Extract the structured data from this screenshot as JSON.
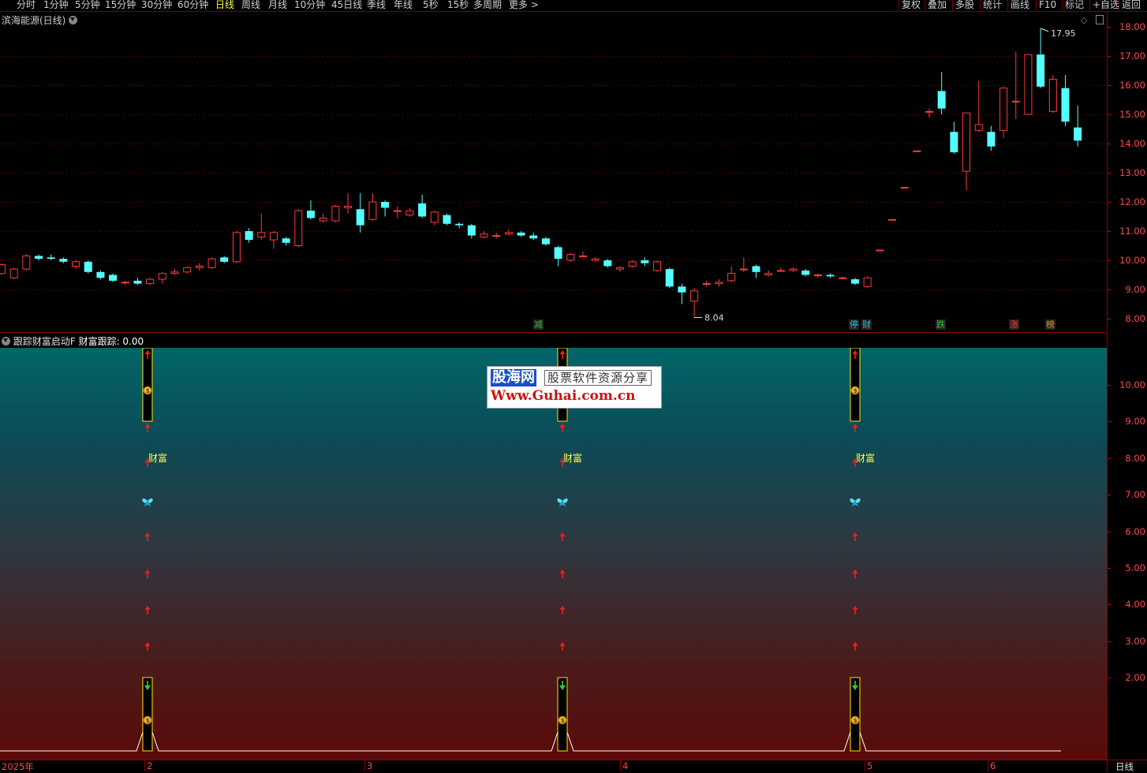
{
  "toolbar": {
    "periods": [
      {
        "label": "分时",
        "active": false
      },
      {
        "label": "1分钟",
        "active": false
      },
      {
        "label": "5分钟",
        "active": false
      },
      {
        "label": "15分钟",
        "active": false
      },
      {
        "label": "30分钟",
        "active": false
      },
      {
        "label": "60分钟",
        "active": false
      },
      {
        "label": "日线",
        "active": true
      },
      {
        "label": "周线",
        "active": false
      },
      {
        "label": "月线",
        "active": false
      },
      {
        "label": "10分钟",
        "active": false
      },
      {
        "label": "45日线",
        "active": false
      },
      {
        "label": "季线",
        "active": false
      },
      {
        "label": "年线",
        "active": false
      },
      {
        "label": "5秒",
        "active": false
      },
      {
        "label": "15秒",
        "active": false
      },
      {
        "label": "多周期",
        "active": false
      },
      {
        "label": "更多 >",
        "active": false
      }
    ],
    "right_items": [
      "复权",
      "叠加",
      "多股",
      "统计",
      "画线",
      "F10",
      "标记",
      "+自选",
      "返回"
    ]
  },
  "main": {
    "title": "滨海能源(日线)",
    "high_label": "17.95",
    "low_label": "8.04",
    "axis_ticks": [
      "18.00",
      "17.00",
      "16.00",
      "15.00",
      "14.00",
      "13.00",
      "12.00",
      "11.00",
      "10.00",
      "9.00",
      "8.00"
    ],
    "marks": [
      {
        "text": "减",
        "color": "#2fbf2f"
      },
      {
        "text": "停",
        "color": "#2fb8d8"
      },
      {
        "text": "财",
        "color": "#2fb8d8"
      },
      {
        "text": "跌",
        "color": "#2fbf2f"
      },
      {
        "text": "涨",
        "color": "#ff3b3b"
      },
      {
        "text": "榜",
        "color": "#e69020"
      }
    ]
  },
  "indicator": {
    "title": "跟踪财富启动F",
    "value_label": "财富跟踪: 0.00",
    "axis_ticks": [
      "10.00",
      "9.00",
      "8.00",
      "7.00",
      "6.00",
      "5.00",
      "4.00",
      "3.00",
      "2.00"
    ],
    "signal_label": "财富",
    "signal_count": 3
  },
  "watermark": {
    "brand": "股海网",
    "slogan": "股票软件资源分享",
    "url": "Www.Guhai.com.cn"
  },
  "date_axis": {
    "labels": [
      "2025年",
      "2",
      "3",
      "4",
      "5",
      "6"
    ],
    "period_label": "日线"
  },
  "chart_data": {
    "type": "candlestick",
    "ylim": [
      7.8,
      18.3
    ],
    "candles": [
      {
        "o": 9.55,
        "c": 9.85,
        "h": 9.9,
        "l": 9.5
      },
      {
        "o": 9.4,
        "c": 9.7,
        "h": 9.75,
        "l": 9.35
      },
      {
        "o": 9.7,
        "c": 10.15,
        "h": 10.2,
        "l": 9.65
      },
      {
        "o": 10.15,
        "c": 10.05,
        "h": 10.2,
        "l": 10.0
      },
      {
        "o": 10.1,
        "c": 10.05,
        "h": 10.2,
        "l": 10.0
      },
      {
        "o": 10.05,
        "c": 9.95,
        "h": 10.1,
        "l": 9.9
      },
      {
        "o": 9.8,
        "c": 9.95,
        "h": 10.0,
        "l": 9.7
      },
      {
        "o": 9.95,
        "c": 9.6,
        "h": 10.0,
        "l": 9.55
      },
      {
        "o": 9.6,
        "c": 9.4,
        "h": 9.65,
        "l": 9.35
      },
      {
        "o": 9.5,
        "c": 9.3,
        "h": 9.55,
        "l": 9.25
      },
      {
        "o": 9.25,
        "c": 9.25,
        "h": 9.3,
        "l": 9.15
      },
      {
        "o": 9.3,
        "c": 9.2,
        "h": 9.4,
        "l": 9.15
      },
      {
        "o": 9.2,
        "c": 9.35,
        "h": 9.4,
        "l": 9.15
      },
      {
        "o": 9.35,
        "c": 9.55,
        "h": 9.6,
        "l": 9.2
      },
      {
        "o": 9.55,
        "c": 9.6,
        "h": 9.7,
        "l": 9.5
      },
      {
        "o": 9.6,
        "c": 9.75,
        "h": 9.8,
        "l": 9.55
      },
      {
        "o": 9.75,
        "c": 9.8,
        "h": 9.9,
        "l": 9.65
      },
      {
        "o": 9.75,
        "c": 10.05,
        "h": 10.1,
        "l": 9.7
      },
      {
        "o": 10.1,
        "c": 9.95,
        "h": 10.15,
        "l": 9.9
      },
      {
        "o": 9.95,
        "c": 10.95,
        "h": 11.0,
        "l": 9.9
      },
      {
        "o": 11.0,
        "c": 10.7,
        "h": 11.1,
        "l": 10.6
      },
      {
        "o": 10.8,
        "c": 10.95,
        "h": 11.6,
        "l": 10.7
      },
      {
        "o": 10.7,
        "c": 10.95,
        "h": 11.0,
        "l": 10.4
      },
      {
        "o": 10.75,
        "c": 10.6,
        "h": 10.8,
        "l": 10.5
      },
      {
        "o": 10.5,
        "c": 11.7,
        "h": 11.75,
        "l": 10.45
      },
      {
        "o": 11.7,
        "c": 11.45,
        "h": 12.05,
        "l": 11.4
      },
      {
        "o": 11.35,
        "c": 11.45,
        "h": 11.6,
        "l": 11.3
      },
      {
        "o": 11.35,
        "c": 11.85,
        "h": 11.9,
        "l": 11.3
      },
      {
        "o": 11.8,
        "c": 11.85,
        "h": 12.3,
        "l": 11.6
      },
      {
        "o": 11.75,
        "c": 11.2,
        "h": 12.3,
        "l": 10.95
      },
      {
        "o": 11.4,
        "c": 12.0,
        "h": 12.3,
        "l": 11.35
      },
      {
        "o": 12.0,
        "c": 11.8,
        "h": 12.05,
        "l": 11.5
      },
      {
        "o": 11.7,
        "c": 11.7,
        "h": 11.85,
        "l": 11.45
      },
      {
        "o": 11.55,
        "c": 11.7,
        "h": 11.8,
        "l": 11.5
      },
      {
        "o": 11.95,
        "c": 11.5,
        "h": 12.25,
        "l": 11.45
      },
      {
        "o": 11.3,
        "c": 11.65,
        "h": 11.7,
        "l": 11.2
      },
      {
        "o": 11.55,
        "c": 11.25,
        "h": 11.6,
        "l": 11.2
      },
      {
        "o": 11.25,
        "c": 11.2,
        "h": 11.3,
        "l": 11.1
      },
      {
        "o": 11.2,
        "c": 10.85,
        "h": 11.25,
        "l": 10.75
      },
      {
        "o": 10.8,
        "c": 10.9,
        "h": 11.0,
        "l": 10.75
      },
      {
        "o": 10.85,
        "c": 10.85,
        "h": 10.95,
        "l": 10.75
      },
      {
        "o": 10.9,
        "c": 10.95,
        "h": 11.05,
        "l": 10.85
      },
      {
        "o": 10.95,
        "c": 10.85,
        "h": 11.0,
        "l": 10.8
      },
      {
        "o": 10.85,
        "c": 10.75,
        "h": 10.95,
        "l": 10.7
      },
      {
        "o": 10.75,
        "c": 10.55,
        "h": 10.8,
        "l": 10.5
      },
      {
        "o": 10.45,
        "c": 10.05,
        "h": 10.5,
        "l": 9.8
      },
      {
        "o": 10.0,
        "c": 10.2,
        "h": 10.25,
        "l": 9.95
      },
      {
        "o": 10.15,
        "c": 10.15,
        "h": 10.3,
        "l": 10.1
      },
      {
        "o": 10.0,
        "c": 10.05,
        "h": 10.1,
        "l": 9.95
      },
      {
        "o": 10.0,
        "c": 9.8,
        "h": 10.05,
        "l": 9.75
      },
      {
        "o": 9.7,
        "c": 9.75,
        "h": 9.8,
        "l": 9.6
      },
      {
        "o": 9.8,
        "c": 9.95,
        "h": 10.0,
        "l": 9.75
      },
      {
        "o": 10.0,
        "c": 9.9,
        "h": 10.1,
        "l": 9.8
      },
      {
        "o": 9.65,
        "c": 9.95,
        "h": 10.0,
        "l": 9.6
      },
      {
        "o": 9.7,
        "c": 9.1,
        "h": 9.75,
        "l": 9.05
      },
      {
        "o": 9.1,
        "c": 8.9,
        "h": 9.2,
        "l": 8.5
      },
      {
        "o": 8.6,
        "c": 8.95,
        "h": 9.05,
        "l": 8.04
      },
      {
        "o": 9.2,
        "c": 9.2,
        "h": 9.3,
        "l": 9.1
      },
      {
        "o": 9.2,
        "c": 9.25,
        "h": 9.35,
        "l": 9.1
      },
      {
        "o": 9.3,
        "c": 9.55,
        "h": 9.8,
        "l": 9.25
      },
      {
        "o": 9.7,
        "c": 9.7,
        "h": 10.1,
        "l": 9.6
      },
      {
        "o": 9.8,
        "c": 9.6,
        "h": 9.85,
        "l": 9.4
      },
      {
        "o": 9.5,
        "c": 9.55,
        "h": 9.65,
        "l": 9.45
      },
      {
        "o": 9.65,
        "c": 9.65,
        "h": 9.75,
        "l": 9.6
      },
      {
        "o": 9.65,
        "c": 9.7,
        "h": 9.75,
        "l": 9.6
      },
      {
        "o": 9.65,
        "c": 9.5,
        "h": 9.7,
        "l": 9.45
      },
      {
        "o": 9.5,
        "c": 9.5,
        "h": 9.55,
        "l": 9.4
      },
      {
        "o": 9.5,
        "c": 9.45,
        "h": 9.55,
        "l": 9.4
      },
      {
        "o": 9.4,
        "c": 9.4,
        "h": 9.45,
        "l": 9.35
      },
      {
        "o": 9.35,
        "c": 9.2,
        "h": 9.4,
        "l": 9.15
      },
      {
        "o": 9.1,
        "c": 9.4,
        "h": 9.45,
        "l": 9.05
      },
      {
        "o": 10.35,
        "c": 10.35,
        "h": 10.35,
        "l": 10.35
      },
      {
        "o": 11.4,
        "c": 11.4,
        "h": 11.4,
        "l": 11.4
      },
      {
        "o": 12.5,
        "c": 12.5,
        "h": 12.5,
        "l": 12.5
      },
      {
        "o": 13.75,
        "c": 13.75,
        "h": 13.75,
        "l": 13.75
      },
      {
        "o": 15.1,
        "c": 15.1,
        "h": 15.2,
        "l": 14.9
      },
      {
        "o": 15.8,
        "c": 15.2,
        "h": 16.45,
        "l": 15.0
      },
      {
        "o": 14.4,
        "c": 13.7,
        "h": 14.75,
        "l": 13.65
      },
      {
        "o": 13.05,
        "c": 15.05,
        "h": 15.05,
        "l": 12.4
      },
      {
        "o": 14.45,
        "c": 14.65,
        "h": 16.15,
        "l": 14.4
      },
      {
        "o": 14.4,
        "c": 13.9,
        "h": 14.6,
        "l": 13.75
      },
      {
        "o": 14.45,
        "c": 15.9,
        "h": 15.95,
        "l": 14.2
      },
      {
        "o": 15.45,
        "c": 15.45,
        "h": 17.15,
        "l": 14.85
      },
      {
        "o": 15.0,
        "c": 17.05,
        "h": 17.05,
        "l": 15.0
      },
      {
        "o": 17.05,
        "c": 15.95,
        "h": 17.95,
        "l": 15.9
      },
      {
        "o": 15.1,
        "c": 16.2,
        "h": 16.35,
        "l": 15.05
      },
      {
        "o": 15.9,
        "c": 14.75,
        "h": 16.35,
        "l": 14.6
      },
      {
        "o": 14.55,
        "c": 14.1,
        "h": 15.3,
        "l": 13.9
      }
    ]
  }
}
